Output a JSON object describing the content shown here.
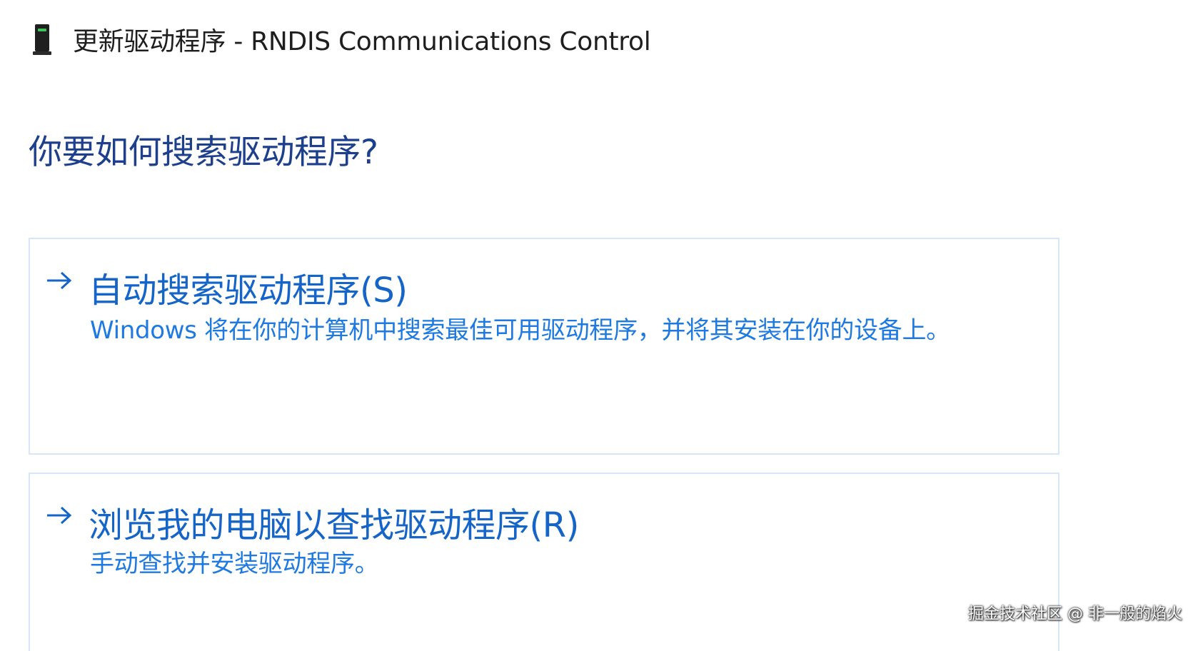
{
  "window": {
    "title": "更新驱动程序 - RNDIS Communications Control",
    "icon": "network-device-icon"
  },
  "main": {
    "question": "你要如何搜索驱动程序?",
    "options": [
      {
        "title": "自动搜索驱动程序(S)",
        "description": "Windows 将在你的计算机中搜索最佳可用驱动程序，并将其安装在你的设备上。",
        "icon": "arrow-right-icon"
      },
      {
        "title": "浏览我的电脑以查找驱动程序(R)",
        "description": "手动查找并安装驱动程序。",
        "icon": "arrow-right-icon"
      }
    ]
  },
  "watermark": "掘金技术社区 @ 非一般的焰火",
  "colors": {
    "heading": "#1d3f8c",
    "link": "#1565c8",
    "description": "#1e7ae0",
    "option_border": "#d7e6f8"
  }
}
